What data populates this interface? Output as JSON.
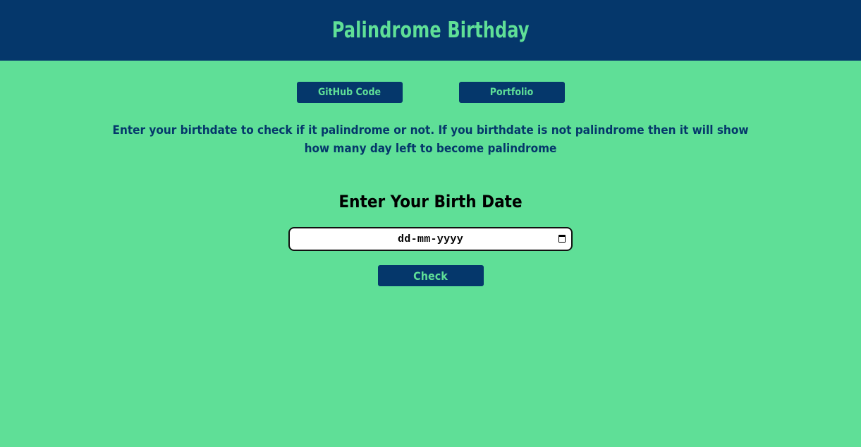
{
  "header": {
    "title": "Palindrome Birthday"
  },
  "links": {
    "github_label": "GitHub Code",
    "portfolio_label": "Portfolio"
  },
  "description": "Enter your birthdate to check if it palindrome or not. If you birthdate is not palindrome then it will show how many day left to become palindrome",
  "form": {
    "title": "Enter Your Birth Date",
    "date_placeholder": "dd-mm-yyyy",
    "date_icon": "calendar-icon",
    "check_label": "Check"
  },
  "colors": {
    "background": "#5fdf97",
    "header_bg": "#05376b",
    "accent_text": "#5fdf97",
    "button_bg": "#05376b"
  }
}
